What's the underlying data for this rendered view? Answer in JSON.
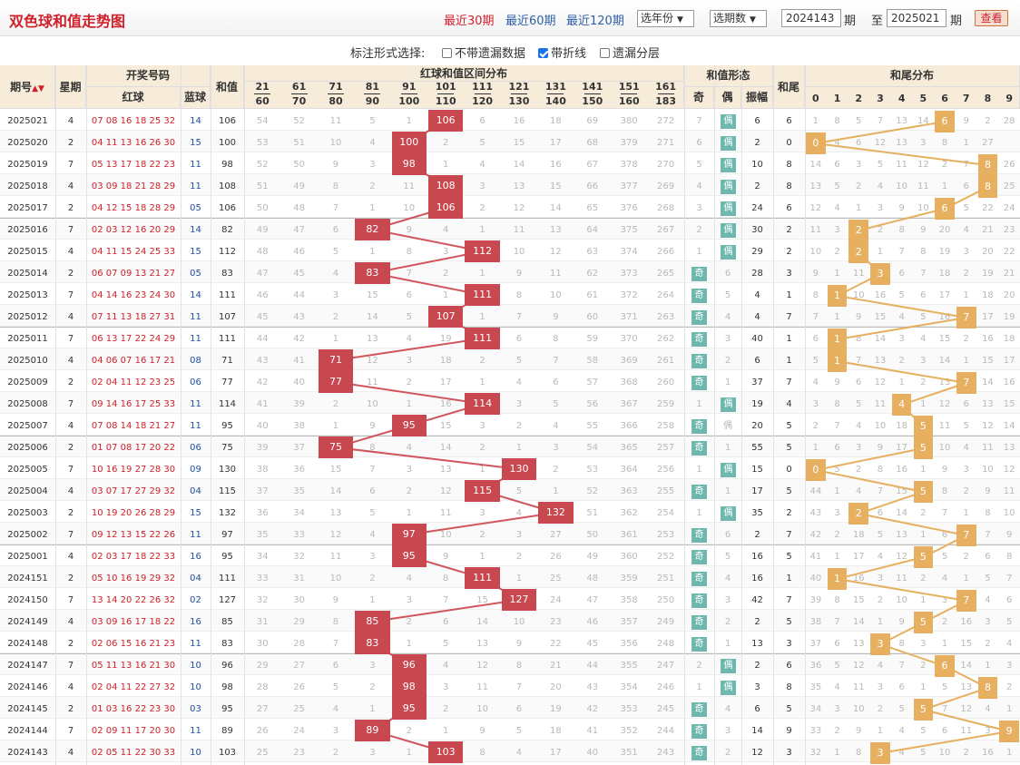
{
  "title": "双色球和值走势图",
  "periods": [
    {
      "label": "最近30期",
      "active": true
    },
    {
      "label": "最近60期",
      "active": false
    },
    {
      "label": "最近120期",
      "active": false
    }
  ],
  "year_select": "选年份",
  "range_select": "选期数",
  "from_issue": "2024143",
  "to_issue": "2025021",
  "qi": "期",
  "zhi": "至",
  "query_btn": "查看",
  "options_label": "标注形式选择:",
  "options": [
    {
      "label": "不带遗漏数据",
      "checked": false
    },
    {
      "label": "带折线",
      "checked": true
    },
    {
      "label": "遗漏分层",
      "checked": false
    }
  ],
  "headers": {
    "issue": "期号",
    "week": "星期",
    "draw": "开奖号码",
    "red": "红球",
    "blue": "蓝球",
    "sum": "和值",
    "range": "红球和值区间分布",
    "form": "和值形态",
    "odd": "奇",
    "even": "偶",
    "amp": "振幅",
    "tail": "和尾",
    "tail_dist": "和尾分布"
  },
  "ranges": [
    [
      "21",
      "60"
    ],
    [
      "61",
      "70"
    ],
    [
      "71",
      "80"
    ],
    [
      "81",
      "90"
    ],
    [
      "91",
      "100"
    ],
    [
      "101",
      "110"
    ],
    [
      "111",
      "120"
    ],
    [
      "121",
      "130"
    ],
    [
      "131",
      "140"
    ],
    [
      "141",
      "150"
    ],
    [
      "151",
      "160"
    ],
    [
      "161",
      "183"
    ]
  ],
  "tail_heads": [
    "0",
    "1",
    "2",
    "3",
    "4",
    "5",
    "6",
    "7",
    "8",
    "9"
  ],
  "rows": [
    {
      "issue": "2025021",
      "week": "4",
      "red": "07 08 16 18 25 32",
      "blue": "14",
      "sum": "106",
      "zone": 5,
      "zm": [
        "54",
        "52",
        "11",
        "5",
        "1",
        "106",
        "6",
        "16",
        "18",
        "69",
        "380",
        "272"
      ],
      "odd": "7",
      "even": "偶",
      "isOdd": false,
      "amp": "6",
      "tail": "6",
      "tm": [
        "1",
        "8",
        "5",
        "7",
        "13",
        "14",
        "6",
        "9",
        "2",
        "28"
      ]
    },
    {
      "issue": "2025020",
      "week": "2",
      "red": "04 11 13 16 26 30",
      "blue": "15",
      "sum": "100",
      "zone": 4,
      "zm": [
        "53",
        "51",
        "10",
        "4",
        "100",
        "2",
        "5",
        "15",
        "17",
        "68",
        "379",
        "271"
      ],
      "odd": "6",
      "even": "偶",
      "isOdd": false,
      "amp": "2",
      "tail": "0",
      "tm": [
        "0",
        "4",
        "6",
        "12",
        "13",
        "3",
        "8",
        "1",
        "27"
      ]
    },
    {
      "issue": "2025019",
      "week": "7",
      "red": "05 13 17 18 22 23",
      "blue": "11",
      "sum": "98",
      "zone": 4,
      "zm": [
        "52",
        "50",
        "9",
        "3",
        "98",
        "1",
        "4",
        "14",
        "16",
        "67",
        "378",
        "270"
      ],
      "odd": "5",
      "even": "偶",
      "isOdd": false,
      "amp": "10",
      "tail": "8",
      "tm": [
        "14",
        "6",
        "3",
        "5",
        "11",
        "12",
        "2",
        "7",
        "8",
        "26"
      ]
    },
    {
      "issue": "2025018",
      "week": "4",
      "red": "03 09 18 21 28 29",
      "blue": "11",
      "sum": "108",
      "zone": 5,
      "zm": [
        "51",
        "49",
        "8",
        "2",
        "11",
        "108",
        "3",
        "13",
        "15",
        "66",
        "377",
        "269"
      ],
      "odd": "4",
      "even": "偶",
      "isOdd": false,
      "amp": "2",
      "tail": "8",
      "tm": [
        "13",
        "5",
        "2",
        "4",
        "10",
        "11",
        "1",
        "6",
        "8",
        "25"
      ]
    },
    {
      "issue": "2025017",
      "week": "2",
      "red": "04 12 15 18 28 29",
      "blue": "05",
      "sum": "106",
      "zone": 5,
      "zm": [
        "50",
        "48",
        "7",
        "1",
        "10",
        "106",
        "2",
        "12",
        "14",
        "65",
        "376",
        "268"
      ],
      "odd": "3",
      "even": "偶",
      "isOdd": false,
      "amp": "24",
      "tail": "6",
      "tm": [
        "12",
        "4",
        "1",
        "3",
        "9",
        "10",
        "6",
        "5",
        "22",
        "24"
      ]
    },
    {
      "issue": "2025016",
      "week": "7",
      "red": "02 03 12 16 20 29",
      "blue": "14",
      "sum": "82",
      "zone": 3,
      "zm": [
        "49",
        "47",
        "6",
        "82",
        "9",
        "4",
        "1",
        "11",
        "13",
        "64",
        "375",
        "267"
      ],
      "odd": "2",
      "even": "偶",
      "isOdd": false,
      "amp": "30",
      "tail": "2",
      "tm": [
        "11",
        "3",
        "2",
        "2",
        "8",
        "9",
        "20",
        "4",
        "21",
        "23"
      ]
    },
    {
      "issue": "2025015",
      "week": "4",
      "red": "04 11 15 24 25 33",
      "blue": "15",
      "sum": "112",
      "zone": 6,
      "zm": [
        "48",
        "46",
        "5",
        "1",
        "8",
        "3",
        "112",
        "10",
        "12",
        "63",
        "374",
        "266"
      ],
      "odd": "1",
      "even": "偶",
      "isOdd": false,
      "amp": "29",
      "tail": "2",
      "tm": [
        "10",
        "2",
        "2",
        "1",
        "7",
        "8",
        "19",
        "3",
        "20",
        "22"
      ]
    },
    {
      "issue": "2025014",
      "week": "2",
      "red": "06 07 09 13 21 27",
      "blue": "05",
      "sum": "83",
      "zone": 3,
      "zm": [
        "47",
        "45",
        "4",
        "83",
        "7",
        "2",
        "1",
        "9",
        "11",
        "62",
        "373",
        "265"
      ],
      "odd": "奇",
      "even": "6",
      "isOdd": true,
      "amp": "28",
      "tail": "3",
      "tm": [
        "9",
        "1",
        "11",
        "3",
        "6",
        "7",
        "18",
        "2",
        "19",
        "21"
      ]
    },
    {
      "issue": "2025013",
      "week": "7",
      "red": "04 14 16 23 24 30",
      "blue": "14",
      "sum": "111",
      "zone": 6,
      "zm": [
        "46",
        "44",
        "3",
        "15",
        "6",
        "1",
        "111",
        "8",
        "10",
        "61",
        "372",
        "264"
      ],
      "odd": "奇",
      "even": "5",
      "isOdd": true,
      "amp": "4",
      "tail": "1",
      "tm": [
        "8",
        "1",
        "10",
        "16",
        "5",
        "6",
        "17",
        "1",
        "18",
        "20"
      ]
    },
    {
      "issue": "2025012",
      "week": "4",
      "red": "07 11 13 18 27 31",
      "blue": "11",
      "sum": "107",
      "zone": 5,
      "zm": [
        "45",
        "43",
        "2",
        "14",
        "5",
        "107",
        "1",
        "7",
        "9",
        "60",
        "371",
        "263"
      ],
      "odd": "奇",
      "even": "4",
      "isOdd": true,
      "amp": "4",
      "tail": "7",
      "tm": [
        "7",
        "1",
        "9",
        "15",
        "4",
        "5",
        "16",
        "7",
        "17",
        "19"
      ]
    },
    {
      "issue": "2025011",
      "week": "7",
      "red": "06 13 17 22 24 29",
      "blue": "11",
      "sum": "111",
      "zone": 6,
      "zm": [
        "44",
        "42",
        "1",
        "13",
        "4",
        "19",
        "111",
        "6",
        "8",
        "59",
        "370",
        "262"
      ],
      "odd": "奇",
      "even": "3",
      "isOdd": true,
      "amp": "40",
      "tail": "1",
      "tm": [
        "6",
        "1",
        "8",
        "14",
        "3",
        "4",
        "15",
        "2",
        "16",
        "18"
      ]
    },
    {
      "issue": "2025010",
      "week": "4",
      "red": "04 06 07 16 17 21",
      "blue": "08",
      "sum": "71",
      "zone": 2,
      "zm": [
        "43",
        "41",
        "71",
        "12",
        "3",
        "18",
        "2",
        "5",
        "7",
        "58",
        "369",
        "261"
      ],
      "odd": "奇",
      "even": "2",
      "isOdd": true,
      "amp": "6",
      "tail": "1",
      "tm": [
        "5",
        "1",
        "7",
        "13",
        "2",
        "3",
        "14",
        "1",
        "15",
        "17"
      ]
    },
    {
      "issue": "2025009",
      "week": "2",
      "red": "02 04 11 12 23 25",
      "blue": "06",
      "sum": "77",
      "zone": 2,
      "zm": [
        "42",
        "40",
        "77",
        "11",
        "2",
        "17",
        "1",
        "4",
        "6",
        "57",
        "368",
        "260"
      ],
      "odd": "奇",
      "even": "1",
      "isOdd": true,
      "amp": "37",
      "tail": "7",
      "tm": [
        "4",
        "9",
        "6",
        "12",
        "1",
        "2",
        "13",
        "7",
        "14",
        "16"
      ]
    },
    {
      "issue": "2025008",
      "week": "7",
      "red": "09 14 16 17 25 33",
      "blue": "11",
      "sum": "114",
      "zone": 6,
      "zm": [
        "41",
        "39",
        "2",
        "10",
        "1",
        "16",
        "114",
        "3",
        "5",
        "56",
        "367",
        "259"
      ],
      "odd": "1",
      "even": "偶",
      "isOdd": false,
      "amp": "19",
      "tail": "4",
      "tm": [
        "3",
        "8",
        "5",
        "11",
        "4",
        "1",
        "12",
        "6",
        "13",
        "15"
      ]
    },
    {
      "issue": "2025007",
      "week": "4",
      "red": "07 08 14 18 21 27",
      "blue": "11",
      "sum": "95",
      "zone": 4,
      "zm": [
        "40",
        "38",
        "1",
        "9",
        "95",
        "15",
        "3",
        "2",
        "4",
        "55",
        "366",
        "258"
      ],
      "odd": "奇",
      "even": "偶",
      "isOdd": true,
      "amp": "20",
      "tail": "5",
      "tm": [
        "2",
        "7",
        "4",
        "10",
        "18",
        "5",
        "11",
        "5",
        "12",
        "14"
      ]
    },
    {
      "issue": "2025006",
      "week": "2",
      "red": "01 07 08 17 20 22",
      "blue": "06",
      "sum": "75",
      "zone": 2,
      "zm": [
        "39",
        "37",
        "75",
        "8",
        "4",
        "14",
        "2",
        "1",
        "3",
        "54",
        "365",
        "257"
      ],
      "odd": "奇",
      "even": "1",
      "isOdd": true,
      "amp": "55",
      "tail": "5",
      "tm": [
        "1",
        "6",
        "3",
        "9",
        "17",
        "5",
        "10",
        "4",
        "11",
        "13"
      ]
    },
    {
      "issue": "2025005",
      "week": "7",
      "red": "10 16 19 27 28 30",
      "blue": "09",
      "sum": "130",
      "zone": 7,
      "zm": [
        "38",
        "36",
        "15",
        "7",
        "3",
        "13",
        "1",
        "130",
        "2",
        "53",
        "364",
        "256"
      ],
      "odd": "1",
      "even": "偶",
      "isOdd": false,
      "amp": "15",
      "tail": "0",
      "tm": [
        "0",
        "5",
        "2",
        "8",
        "16",
        "1",
        "9",
        "3",
        "10",
        "12"
      ]
    },
    {
      "issue": "2025004",
      "week": "4",
      "red": "03 07 17 27 29 32",
      "blue": "04",
      "sum": "115",
      "zone": 6,
      "zm": [
        "37",
        "35",
        "14",
        "6",
        "2",
        "12",
        "115",
        "5",
        "1",
        "52",
        "363",
        "255"
      ],
      "odd": "奇",
      "even": "1",
      "isOdd": true,
      "amp": "17",
      "tail": "5",
      "tm": [
        "44",
        "1",
        "4",
        "7",
        "15",
        "5",
        "8",
        "2",
        "9",
        "11"
      ]
    },
    {
      "issue": "2025003",
      "week": "2",
      "red": "10 19 20 26 28 29",
      "blue": "15",
      "sum": "132",
      "zone": 8,
      "zm": [
        "36",
        "34",
        "13",
        "5",
        "1",
        "11",
        "3",
        "4",
        "132",
        "51",
        "362",
        "254"
      ],
      "odd": "1",
      "even": "偶",
      "isOdd": false,
      "amp": "35",
      "tail": "2",
      "tm": [
        "43",
        "3",
        "2",
        "6",
        "14",
        "2",
        "7",
        "1",
        "8",
        "10"
      ]
    },
    {
      "issue": "2025002",
      "week": "7",
      "red": "09 12 13 15 22 26",
      "blue": "11",
      "sum": "97",
      "zone": 4,
      "zm": [
        "35",
        "33",
        "12",
        "4",
        "97",
        "10",
        "2",
        "3",
        "27",
        "50",
        "361",
        "253"
      ],
      "odd": "奇",
      "even": "6",
      "isOdd": true,
      "amp": "2",
      "tail": "7",
      "tm": [
        "42",
        "2",
        "18",
        "5",
        "13",
        "1",
        "6",
        "7",
        "7",
        "9"
      ]
    },
    {
      "issue": "2025001",
      "week": "4",
      "red": "02 03 17 18 22 33",
      "blue": "16",
      "sum": "95",
      "zone": 4,
      "zm": [
        "34",
        "32",
        "11",
        "3",
        "95",
        "9",
        "1",
        "2",
        "26",
        "49",
        "360",
        "252"
      ],
      "odd": "奇",
      "even": "5",
      "isOdd": true,
      "amp": "16",
      "tail": "5",
      "tm": [
        "41",
        "1",
        "17",
        "4",
        "12",
        "5",
        "5",
        "2",
        "6",
        "8"
      ]
    },
    {
      "issue": "2024151",
      "week": "2",
      "red": "05 10 16 19 29 32",
      "blue": "04",
      "sum": "111",
      "zone": 6,
      "zm": [
        "33",
        "31",
        "10",
        "2",
        "4",
        "8",
        "111",
        "1",
        "25",
        "48",
        "359",
        "251"
      ],
      "odd": "奇",
      "even": "4",
      "isOdd": true,
      "amp": "16",
      "tail": "1",
      "tm": [
        "40",
        "1",
        "16",
        "3",
        "11",
        "2",
        "4",
        "1",
        "5",
        "7"
      ]
    },
    {
      "issue": "2024150",
      "week": "7",
      "red": "13 14 20 22 26 32",
      "blue": "02",
      "sum": "127",
      "zone": 7,
      "zm": [
        "32",
        "30",
        "9",
        "1",
        "3",
        "7",
        "15",
        "127",
        "24",
        "47",
        "358",
        "250"
      ],
      "odd": "奇",
      "even": "3",
      "isOdd": true,
      "amp": "42",
      "tail": "7",
      "tm": [
        "39",
        "8",
        "15",
        "2",
        "10",
        "1",
        "3",
        "7",
        "4",
        "6"
      ]
    },
    {
      "issue": "2024149",
      "week": "4",
      "red": "03 09 16 17 18 22",
      "blue": "16",
      "sum": "85",
      "zone": 3,
      "zm": [
        "31",
        "29",
        "8",
        "85",
        "2",
        "6",
        "14",
        "10",
        "23",
        "46",
        "357",
        "249"
      ],
      "odd": "奇",
      "even": "2",
      "isOdd": true,
      "amp": "2",
      "tail": "5",
      "tm": [
        "38",
        "7",
        "14",
        "1",
        "9",
        "5",
        "2",
        "16",
        "3",
        "5"
      ]
    },
    {
      "issue": "2024148",
      "week": "2",
      "red": "02 06 15 16 21 23",
      "blue": "11",
      "sum": "83",
      "zone": 3,
      "zm": [
        "30",
        "28",
        "7",
        "83",
        "1",
        "5",
        "13",
        "9",
        "22",
        "45",
        "356",
        "248"
      ],
      "odd": "奇",
      "even": "1",
      "isOdd": true,
      "amp": "13",
      "tail": "3",
      "tm": [
        "37",
        "6",
        "13",
        "3",
        "8",
        "3",
        "1",
        "15",
        "2",
        "4"
      ]
    },
    {
      "issue": "2024147",
      "week": "7",
      "red": "05 11 13 16 21 30",
      "blue": "10",
      "sum": "96",
      "zone": 4,
      "zm": [
        "29",
        "27",
        "6",
        "3",
        "96",
        "4",
        "12",
        "8",
        "21",
        "44",
        "355",
        "247"
      ],
      "odd": "2",
      "even": "偶",
      "isOdd": false,
      "amp": "2",
      "tail": "6",
      "tm": [
        "36",
        "5",
        "12",
        "4",
        "7",
        "2",
        "6",
        "14",
        "1",
        "3"
      ]
    },
    {
      "issue": "2024146",
      "week": "4",
      "red": "02 04 11 22 27 32",
      "blue": "10",
      "sum": "98",
      "zone": 4,
      "zm": [
        "28",
        "26",
        "5",
        "2",
        "98",
        "3",
        "11",
        "7",
        "20",
        "43",
        "354",
        "246"
      ],
      "odd": "1",
      "even": "偶",
      "isOdd": false,
      "amp": "3",
      "tail": "8",
      "tm": [
        "35",
        "4",
        "11",
        "3",
        "6",
        "1",
        "5",
        "13",
        "8",
        "2"
      ]
    },
    {
      "issue": "2024145",
      "week": "2",
      "red": "01 03 16 22 23 30",
      "blue": "03",
      "sum": "95",
      "zone": 4,
      "zm": [
        "27",
        "25",
        "4",
        "1",
        "95",
        "2",
        "10",
        "6",
        "19",
        "42",
        "353",
        "245"
      ],
      "odd": "奇",
      "even": "4",
      "isOdd": true,
      "amp": "6",
      "tail": "5",
      "tm": [
        "34",
        "3",
        "10",
        "2",
        "5",
        "5",
        "7",
        "12",
        "4",
        "1"
      ]
    },
    {
      "issue": "2024144",
      "week": "7",
      "red": "02 09 11 17 20 30",
      "blue": "11",
      "sum": "89",
      "zone": 3,
      "zm": [
        "26",
        "24",
        "3",
        "89",
        "2",
        "1",
        "9",
        "5",
        "18",
        "41",
        "352",
        "244"
      ],
      "odd": "奇",
      "even": "3",
      "isOdd": true,
      "amp": "14",
      "tail": "9",
      "tm": [
        "33",
        "2",
        "9",
        "1",
        "4",
        "5",
        "6",
        "11",
        "3",
        "9"
      ]
    },
    {
      "issue": "2024143",
      "week": "4",
      "red": "02 05 11 22 30 33",
      "blue": "10",
      "sum": "103",
      "zone": 5,
      "zm": [
        "25",
        "23",
        "2",
        "3",
        "1",
        "103",
        "8",
        "4",
        "17",
        "40",
        "351",
        "243"
      ],
      "odd": "奇",
      "even": "2",
      "isOdd": true,
      "amp": "12",
      "tail": "3",
      "tm": [
        "32",
        "1",
        "8",
        "3",
        "4",
        "5",
        "10",
        "2",
        "16",
        "1"
      ]
    }
  ]
}
